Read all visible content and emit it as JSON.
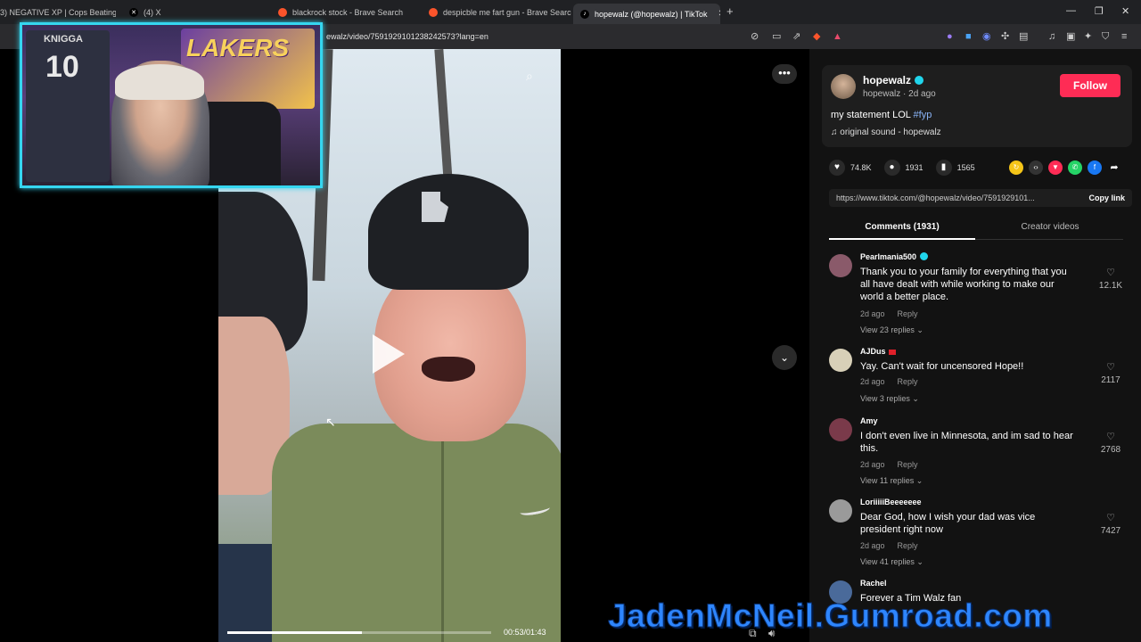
{
  "browser": {
    "tabs": [
      {
        "title": "3) NEGATIVE XP | Cops Beating D",
        "color": "#e53935"
      },
      {
        "title": "(4) X",
        "color": "#000000"
      },
      {
        "title": "blackrock stock - Brave Search",
        "color": "#fb542b"
      },
      {
        "title": "despicble me fart gun - Brave Search",
        "color": "#fb542b"
      },
      {
        "title": "hopewalz (@hopewalz) | TikTok",
        "color": "#000000"
      }
    ],
    "url": "ewalz/video/7591929101238242573?lang=en"
  },
  "webcam": {
    "jersey_name": "KNIGGA",
    "jersey_number": "10",
    "banner": "LAKERS"
  },
  "video": {
    "current_time": "00:53/01:43",
    "progress": 0.51
  },
  "watermark": "JadenMcNeil.Gumroad.com",
  "author": {
    "name": "hopewalz",
    "sub": "hopewalz · 2d ago",
    "follow_label": "Follow",
    "caption": "my statement LOL ",
    "hashtag": "#fyp",
    "sound": "original sound - hopewalz"
  },
  "stats": {
    "likes": "74.8K",
    "comments": "1931",
    "saves": "1565"
  },
  "share": {
    "link": "https://www.tiktok.com/@hopewalz/video/7591929101...",
    "copy_label": "Copy link"
  },
  "tabs": {
    "comments": "Comments (1931)",
    "creator": "Creator videos"
  },
  "comments": [
    {
      "user": "Pearlmania500",
      "text": "Thank you to your family for everything that you all have dealt with while working to make our world a better place.",
      "time": "2d ago",
      "reply": "Reply",
      "replies": "View 23 replies",
      "likes": "12.1K",
      "avatar": "#8a5a6a"
    },
    {
      "user": "AJDus",
      "text": "Yay. Can't wait for uncensored Hope!!",
      "time": "2d ago",
      "reply": "Reply",
      "replies": "View 3 replies",
      "likes": "2117",
      "avatar": "#d8d0b8"
    },
    {
      "user": "Amy",
      "text": "I don't even live in Minnesota, and im sad to hear this.",
      "time": "2d ago",
      "reply": "Reply",
      "replies": "View 11 replies",
      "likes": "2768",
      "avatar": "#7a3a4a"
    },
    {
      "user": "LoriiiiiBeeeeeee",
      "text": "Dear God, how I wish your dad was vice president right now",
      "time": "2d ago",
      "reply": "Reply",
      "replies": "View 41 replies",
      "likes": "7427",
      "avatar": "#9a9a9a"
    },
    {
      "user": "Rachel",
      "text": "Forever a Tim Walz fan",
      "time": "",
      "reply": "",
      "replies": "",
      "likes": "",
      "avatar": "#4a6a9a"
    }
  ]
}
